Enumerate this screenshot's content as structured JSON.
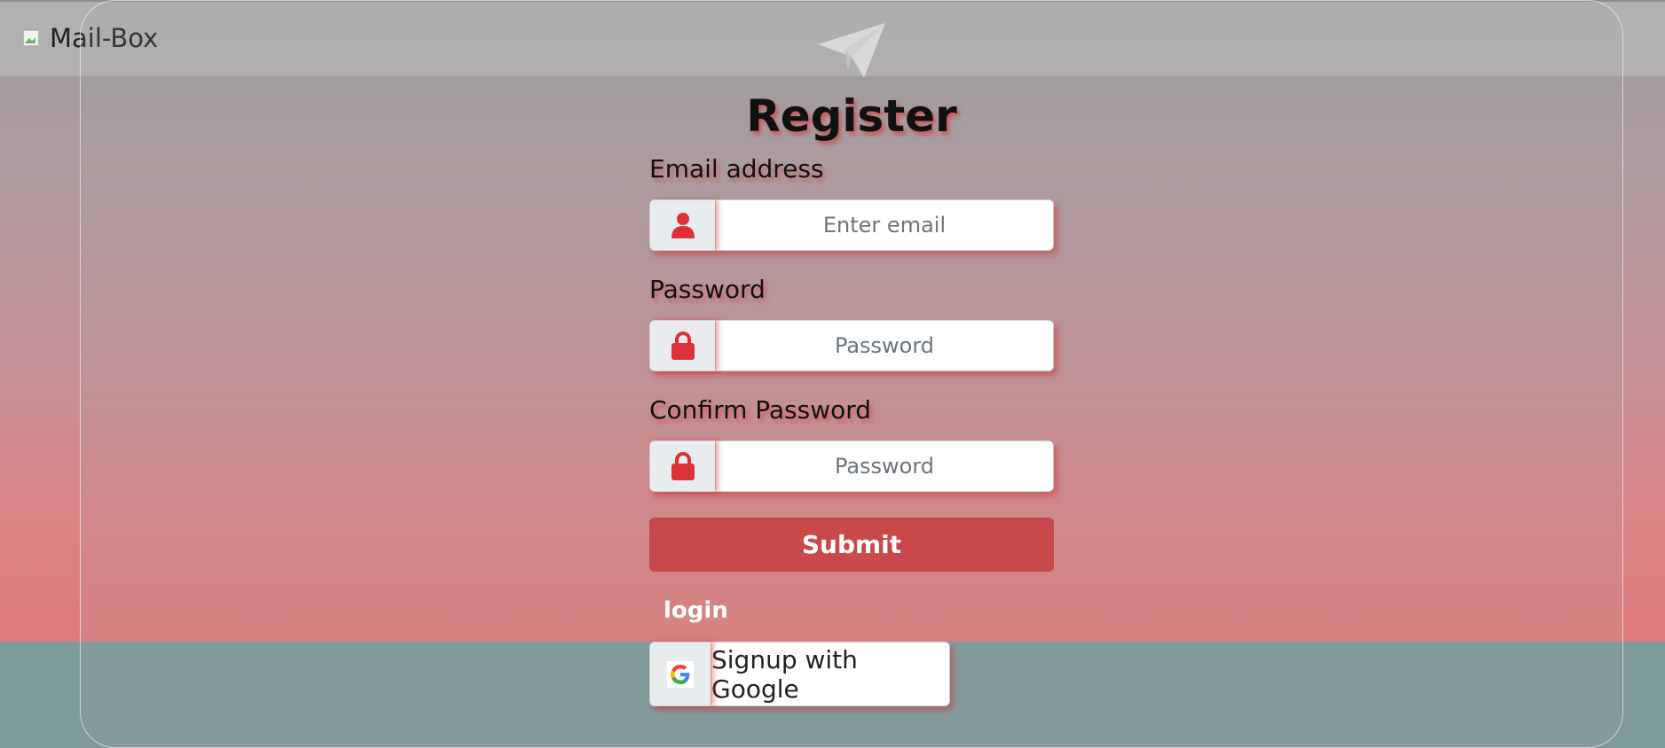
{
  "brand": {
    "name": "Mail-Box",
    "logo_icon": "broken-image-icon"
  },
  "form": {
    "title": "Register",
    "email": {
      "label": "Email address",
      "placeholder": "Enter email",
      "value": "",
      "icon": "user-icon"
    },
    "password": {
      "label": "Password",
      "placeholder": "Password",
      "value": "",
      "icon": "lock-icon"
    },
    "confirm_password": {
      "label": "Confirm Password",
      "placeholder": "Password",
      "value": "",
      "icon": "lock-icon"
    },
    "submit_label": "Submit",
    "login_link": "login",
    "google_label": "Signup with Google"
  },
  "colors": {
    "accent_red": "#c8494b",
    "icon_red": "#dc3236",
    "field_border": "#ced4da",
    "addon_bg": "#e9ecef"
  }
}
